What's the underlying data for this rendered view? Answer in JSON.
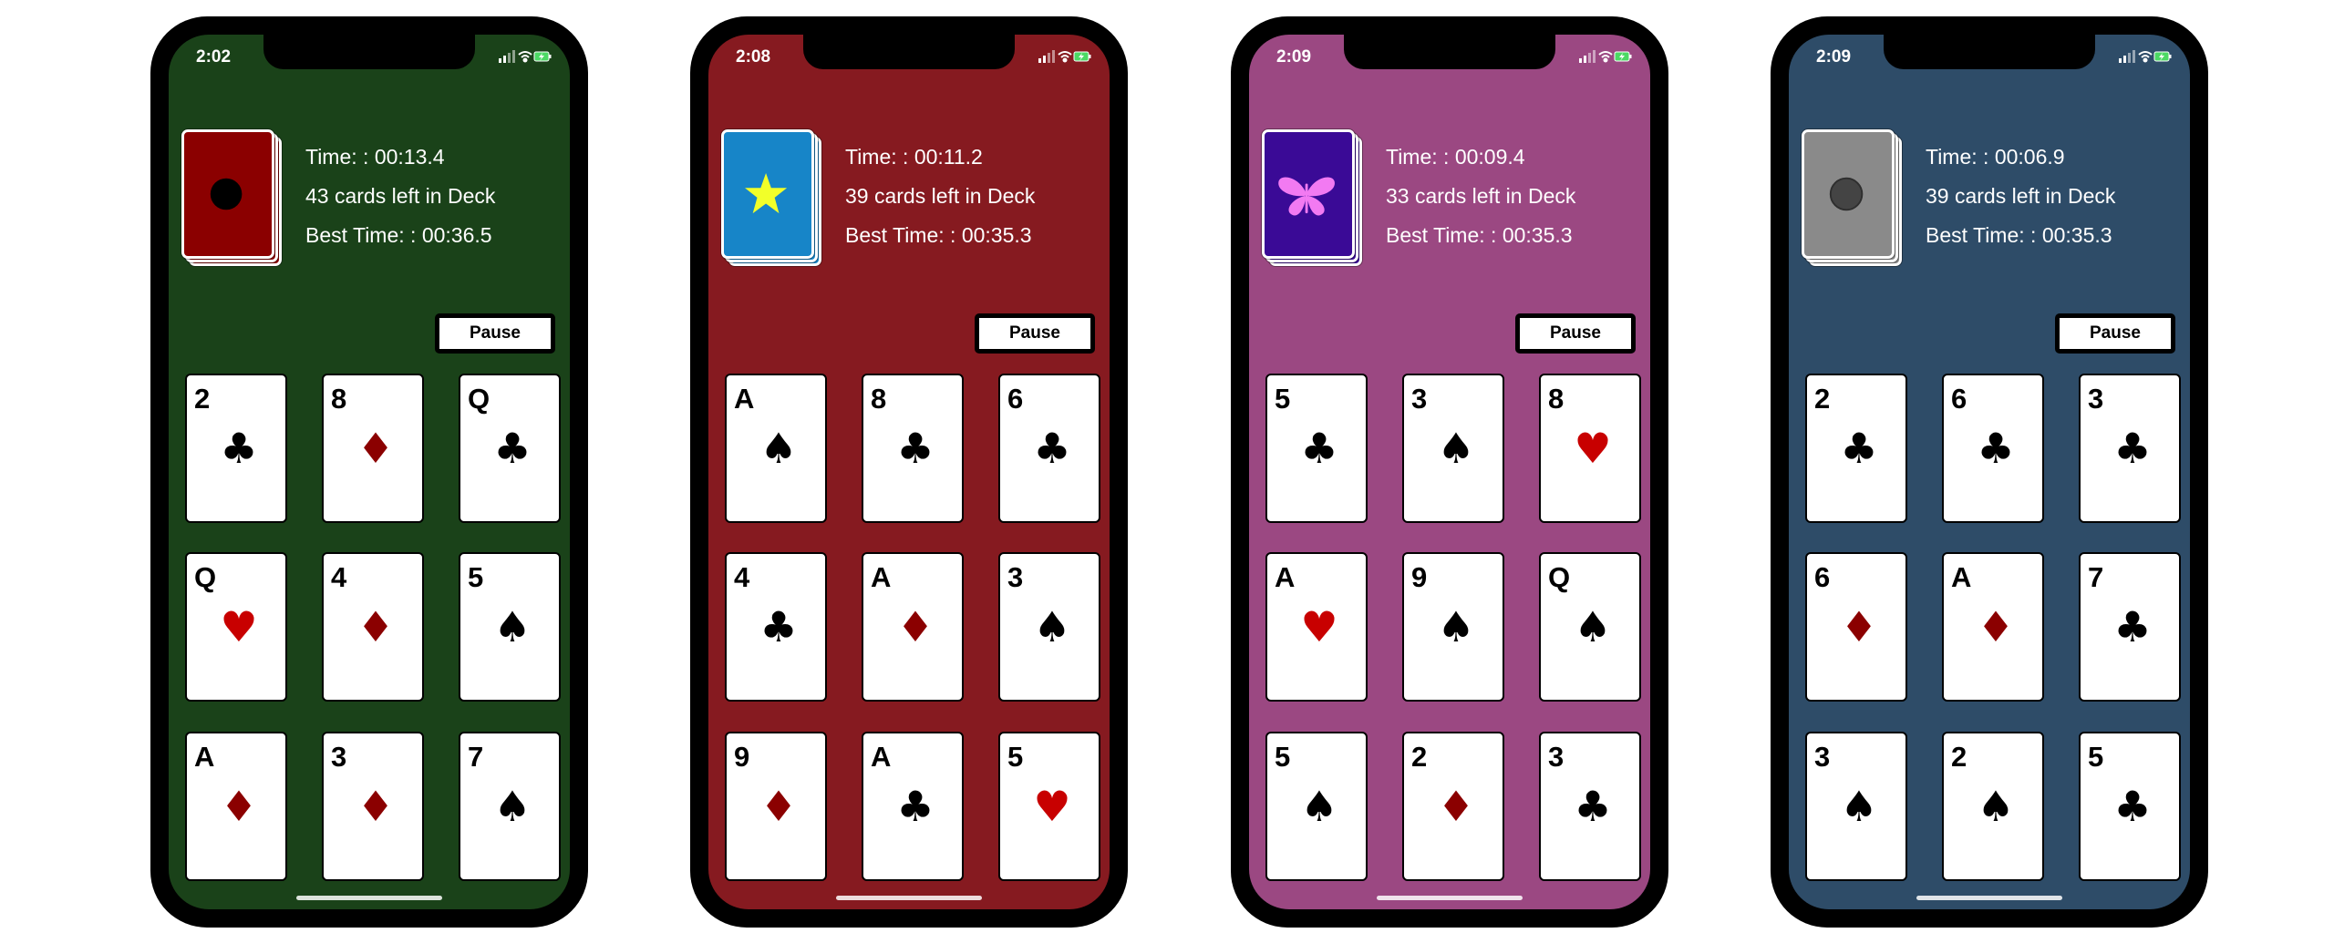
{
  "phones": [
    {
      "theme": {
        "background": "#1a4219",
        "deck_color": "#8b0000",
        "deck_symbol": "circle",
        "symbol_color": "#000000"
      },
      "status": {
        "time": "2:02"
      },
      "info": {
        "time_text": "Time: : 00:13.4",
        "cards_left_text": "43 cards left in Deck",
        "best_time_text": "Best Time: : 00:36.5"
      },
      "pause_label": "Pause",
      "cards": [
        {
          "rank": "2",
          "suit": "clubs",
          "glyph": "♣"
        },
        {
          "rank": "8",
          "suit": "diamonds",
          "glyph": "♦"
        },
        {
          "rank": "Q",
          "suit": "clubs",
          "glyph": "♣"
        },
        {
          "rank": "Q",
          "suit": "hearts",
          "glyph": "♥"
        },
        {
          "rank": "4",
          "suit": "diamonds",
          "glyph": "♦"
        },
        {
          "rank": "5",
          "suit": "spades",
          "glyph": "♠"
        },
        {
          "rank": "A",
          "suit": "diamonds",
          "glyph": "♦"
        },
        {
          "rank": "3",
          "suit": "diamonds",
          "glyph": "♦"
        },
        {
          "rank": "7",
          "suit": "spades",
          "glyph": "♠"
        }
      ]
    },
    {
      "theme": {
        "background": "#861a20",
        "deck_color": "#1785c8",
        "deck_symbol": "star",
        "symbol_color": "#f2ff29"
      },
      "status": {
        "time": "2:08"
      },
      "info": {
        "time_text": "Time: : 00:11.2",
        "cards_left_text": "39 cards left in Deck",
        "best_time_text": "Best Time: : 00:35.3"
      },
      "pause_label": "Pause",
      "cards": [
        {
          "rank": "A",
          "suit": "spades",
          "glyph": "♠"
        },
        {
          "rank": "8",
          "suit": "clubs",
          "glyph": "♣"
        },
        {
          "rank": "6",
          "suit": "clubs",
          "glyph": "♣"
        },
        {
          "rank": "4",
          "suit": "clubs",
          "glyph": "♣"
        },
        {
          "rank": "A",
          "suit": "diamonds",
          "glyph": "♦"
        },
        {
          "rank": "3",
          "suit": "spades",
          "glyph": "♠"
        },
        {
          "rank": "9",
          "suit": "diamonds",
          "glyph": "♦"
        },
        {
          "rank": "A",
          "suit": "clubs",
          "glyph": "♣"
        },
        {
          "rank": "5",
          "suit": "hearts",
          "glyph": "♥"
        }
      ]
    },
    {
      "theme": {
        "background": "#9b4882",
        "deck_color": "#3a0a96",
        "deck_symbol": "butterfly",
        "symbol_color": "#f27af2"
      },
      "status": {
        "time": "2:09"
      },
      "info": {
        "time_text": "Time: : 00:09.4",
        "cards_left_text": "33 cards left in Deck",
        "best_time_text": "Best Time: : 00:35.3"
      },
      "pause_label": "Pause",
      "cards": [
        {
          "rank": "5",
          "suit": "clubs",
          "glyph": "♣"
        },
        {
          "rank": "3",
          "suit": "spades",
          "glyph": "♠"
        },
        {
          "rank": "8",
          "suit": "hearts",
          "glyph": "♥"
        },
        {
          "rank": "A",
          "suit": "hearts",
          "glyph": "♥"
        },
        {
          "rank": "9",
          "suit": "spades",
          "glyph": "♠"
        },
        {
          "rank": "Q",
          "suit": "spades",
          "glyph": "♠"
        },
        {
          "rank": "5",
          "suit": "spades",
          "glyph": "♠"
        },
        {
          "rank": "2",
          "suit": "diamonds",
          "glyph": "♦"
        },
        {
          "rank": "3",
          "suit": "clubs",
          "glyph": "♣"
        }
      ]
    },
    {
      "theme": {
        "background": "#2e4c68",
        "deck_color": "#8a8a8a",
        "deck_symbol": "circle",
        "symbol_color": "#444444"
      },
      "status": {
        "time": "2:09"
      },
      "info": {
        "time_text": "Time: : 00:06.9",
        "cards_left_text": "39 cards left in Deck",
        "best_time_text": "Best Time: : 00:35.3"
      },
      "pause_label": "Pause",
      "cards": [
        {
          "rank": "2",
          "suit": "clubs",
          "glyph": "♣"
        },
        {
          "rank": "6",
          "suit": "clubs",
          "glyph": "♣"
        },
        {
          "rank": "3",
          "suit": "clubs",
          "glyph": "♣"
        },
        {
          "rank": "6",
          "suit": "diamonds",
          "glyph": "♦"
        },
        {
          "rank": "A",
          "suit": "diamonds",
          "glyph": "♦"
        },
        {
          "rank": "7",
          "suit": "clubs",
          "glyph": "♣"
        },
        {
          "rank": "3",
          "suit": "spades",
          "glyph": "♠"
        },
        {
          "rank": "2",
          "suit": "spades",
          "glyph": "♠"
        },
        {
          "rank": "5",
          "suit": "clubs",
          "glyph": "♣"
        }
      ]
    }
  ]
}
